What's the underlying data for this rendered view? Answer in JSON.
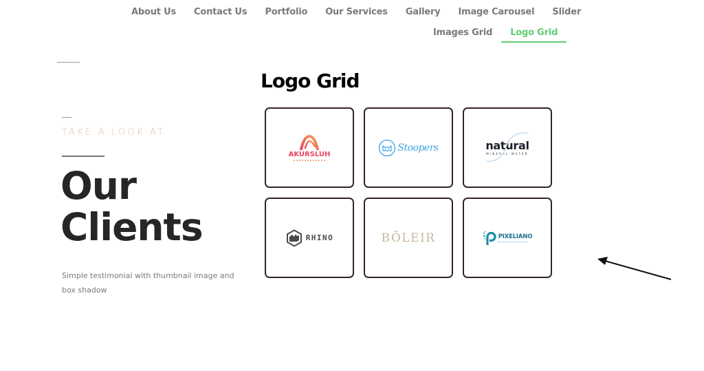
{
  "nav": {
    "row1": [
      {
        "label": "About Us"
      },
      {
        "label": "Contact Us"
      },
      {
        "label": "Portfolio"
      },
      {
        "label": "Our Services"
      },
      {
        "label": "Gallery"
      },
      {
        "label": "Image Carousel"
      },
      {
        "label": "Slider"
      }
    ],
    "row2": [
      {
        "label": "Images Grid"
      },
      {
        "label": "Logo Grid",
        "active": true
      }
    ],
    "active_color": "#61ce70"
  },
  "intro": {
    "tagline": "TAKE A LOOK AT",
    "title_line1": "Our",
    "title_line2": "Clients",
    "description": "Simple testimonial with thumbnail image and box shadow"
  },
  "logo_grid": {
    "title": "Logo Grid",
    "logos": [
      {
        "name": "AKURSLUH",
        "icon": "arch-icon",
        "color": "#e8445f"
      },
      {
        "name": "Stoopers",
        "icon": "cat-face-icon",
        "color": "#3fa3e3"
      },
      {
        "name": "natural",
        "subtitle": "MINERAL WATER",
        "icon": "wave-swirl-icon",
        "color": "#1f1f2a"
      },
      {
        "name": "RHINO",
        "icon": "rhino-hexagon-icon",
        "color": "#4a4a4a"
      },
      {
        "name": "BŌLEIR",
        "color": "#c8b79c"
      },
      {
        "name": "PIXELIANO",
        "icon": "pixel-p-icon",
        "color": "#1b6f8a"
      }
    ]
  },
  "annotation": {
    "icon": "pointer-arrow-icon"
  }
}
